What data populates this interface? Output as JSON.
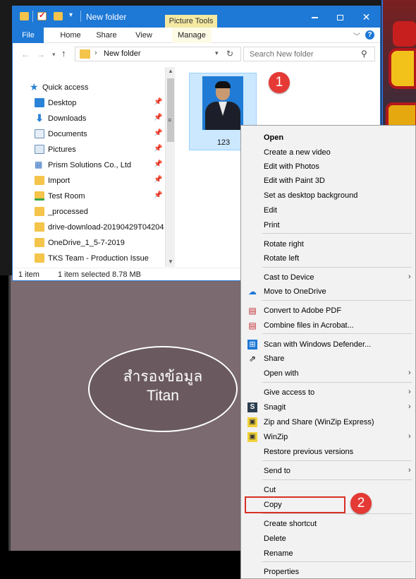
{
  "window": {
    "title": "New folder",
    "contextual_tab": "Picture Tools",
    "tabs": [
      "File",
      "Home",
      "Share",
      "View",
      "Manage"
    ]
  },
  "address": {
    "path": "New folder",
    "search_placeholder": "Search New folder"
  },
  "nav_pane": {
    "quick_access": "Quick access",
    "items": [
      {
        "label": "Desktop",
        "icon": "desktop-icon",
        "pinned": true
      },
      {
        "label": "Downloads",
        "icon": "downloads-icon",
        "pinned": true
      },
      {
        "label": "Documents",
        "icon": "documents-icon",
        "pinned": true
      },
      {
        "label": "Pictures",
        "icon": "pictures-icon",
        "pinned": true
      },
      {
        "label": "Prism Solutions Co., Ltd",
        "icon": "building-icon",
        "pinned": true
      },
      {
        "label": "Import",
        "icon": "folder-icon",
        "pinned": true
      },
      {
        "label": "Test Room",
        "icon": "folder-icon",
        "pinned": true
      },
      {
        "label": "_processed",
        "icon": "folder-icon",
        "pinned": false
      },
      {
        "label": "drive-download-20190429T04204",
        "icon": "folder-icon",
        "pinned": false
      },
      {
        "label": "OneDrive_1_5-7-2019",
        "icon": "folder-icon",
        "pinned": false
      },
      {
        "label": "TKS Team - Production Issue",
        "icon": "folder-icon",
        "pinned": false
      }
    ]
  },
  "files": [
    {
      "name": "123",
      "selected": true
    }
  ],
  "status": {
    "count": "1 item",
    "selection": "1 item selected  8.78 MB"
  },
  "context_menu": {
    "items": [
      {
        "label": "Open",
        "bold": true
      },
      {
        "label": "Create a new video"
      },
      {
        "label": "Edit with Photos"
      },
      {
        "label": "Edit with Paint 3D"
      },
      {
        "label": "Set as desktop background"
      },
      {
        "label": "Edit"
      },
      {
        "label": "Print"
      },
      {
        "label": "Rotate right"
      },
      {
        "label": "Rotate left"
      },
      {
        "label": "Cast to Device",
        "submenu": true
      },
      {
        "label": "Move to OneDrive",
        "icon": "onedrive-icon"
      },
      {
        "label": "Convert to Adobe PDF",
        "icon": "adobe-pdf-icon"
      },
      {
        "label": "Combine files in Acrobat...",
        "icon": "acrobat-icon"
      },
      {
        "label": "Scan with Windows Defender...",
        "icon": "defender-icon"
      },
      {
        "label": "Share",
        "icon": "share-icon"
      },
      {
        "label": "Open with",
        "submenu": true
      },
      {
        "label": "Give access to",
        "submenu": true
      },
      {
        "label": "Snagit",
        "icon": "snagit-icon",
        "submenu": true
      },
      {
        "label": "Zip and Share (WinZip Express)",
        "icon": "winzip-icon"
      },
      {
        "label": "WinZip",
        "icon": "winzip-icon",
        "submenu": true
      },
      {
        "label": "Restore previous versions"
      },
      {
        "label": "Send to",
        "submenu": true
      },
      {
        "label": "Cut"
      },
      {
        "label": "Copy",
        "highlighted": true
      },
      {
        "label": "Create shortcut"
      },
      {
        "label": "Delete"
      },
      {
        "label": "Rename"
      },
      {
        "label": "Properties"
      }
    ]
  },
  "callouts": [
    "1",
    "2"
  ],
  "background_text": {
    "line1": "สำรองข้อมูล",
    "line2": "Titan"
  },
  "colors": {
    "accent": "#1d78d6",
    "callout": "#e53935",
    "selection": "#cce8ff",
    "highlight_box": "#d93025"
  }
}
